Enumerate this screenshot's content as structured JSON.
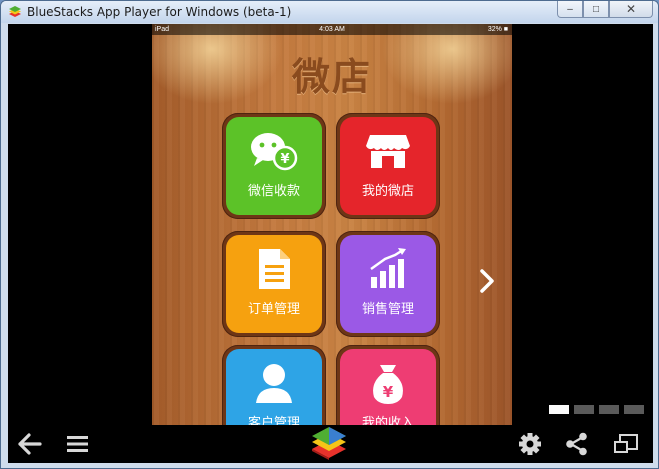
{
  "window": {
    "title": "BlueStacks App Player for Windows (beta-1)",
    "buttons": {
      "minimize": "–",
      "maximize": "□",
      "close": "✕"
    }
  },
  "statusbar": {
    "device": "iPad",
    "time": "4:03 AM",
    "battery": "32% ■"
  },
  "app": {
    "title": "微店"
  },
  "tiles": [
    {
      "label": "微信收款",
      "color": "#5cc228",
      "icon": "wechat-pay-icon"
    },
    {
      "label": "我的微店",
      "color": "#e5252b",
      "icon": "storefront-icon"
    },
    {
      "label": "订单管理",
      "color": "#f6a10f",
      "icon": "document-icon"
    },
    {
      "label": "销售管理",
      "color": "#9b59e6",
      "icon": "sales-chart-icon"
    },
    {
      "label": "客户管理",
      "color": "#2ea4e6",
      "icon": "person-icon"
    },
    {
      "label": "我的收入",
      "color": "#ee3d73",
      "icon": "money-bag-icon"
    }
  ],
  "pager": {
    "pages": 4,
    "active": 1
  },
  "navbar": {
    "icons": [
      "back-icon",
      "menu-icon",
      "bluestacks-logo-icon",
      "settings-icon",
      "share-icon",
      "window-resize-icon"
    ]
  }
}
